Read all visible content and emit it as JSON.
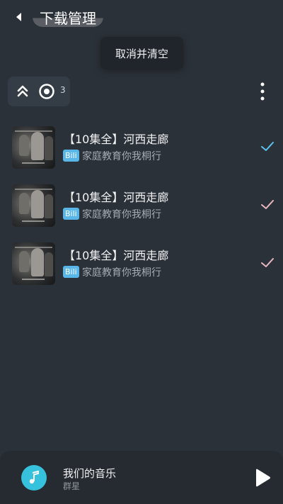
{
  "header": {
    "title": "下载管理"
  },
  "popup": {
    "label": "取消并清空"
  },
  "toolbar": {
    "count": "3"
  },
  "downloads": [
    {
      "title": "【10集全】河西走廊",
      "badge": "Bili",
      "author": "家庭教育你我桐行",
      "status": "done"
    },
    {
      "title": "【10集全】河西走廊",
      "badge": "Bili",
      "author": "家庭教育你我桐行",
      "status": "done"
    },
    {
      "title": "【10集全】河西走廊",
      "badge": "Bili",
      "author": "家庭教育你我桐行",
      "status": "done"
    }
  ],
  "player": {
    "song": "我们的音乐",
    "artist": "群星"
  },
  "colors": {
    "background": "#2b3138",
    "accent": "#36c1dc",
    "check_first": "#5cc3ef",
    "check_other": "#e8b7c0",
    "badge": "#58b6e8"
  },
  "icons": [
    "back-arrow-icon",
    "collapse-up-icon",
    "target-icon",
    "more-vertical-icon",
    "check-icon",
    "music-note-icon",
    "play-icon"
  ]
}
